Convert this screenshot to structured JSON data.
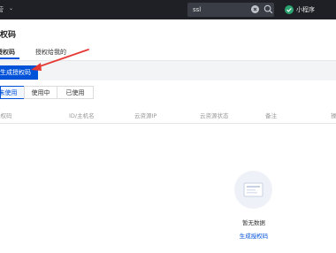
{
  "topbar": {
    "nav_title": "运营",
    "search_value": "ssl",
    "mini_program_label": "小程序"
  },
  "page": {
    "title": "授权码"
  },
  "tabs": [
    {
      "label": "我的授权码"
    },
    {
      "label": "授权给我的"
    }
  ],
  "toolbar": {
    "generate_label": "生成授权码"
  },
  "filters": [
    {
      "label": "未使用"
    },
    {
      "label": "使用中"
    },
    {
      "label": "已使用"
    }
  ],
  "table": {
    "columns": [
      "授权码",
      "ID/主机名",
      "云资源IP",
      "云资源状态",
      "备注",
      "操作"
    ]
  },
  "empty": {
    "message": "暂无数据",
    "action_label": "生成授权码"
  },
  "colors": {
    "topbar_bg": "#1e2025",
    "accent": "#0052d9",
    "annotation_arrow": "#e53935",
    "mini_program_icon": "#2ba471"
  }
}
